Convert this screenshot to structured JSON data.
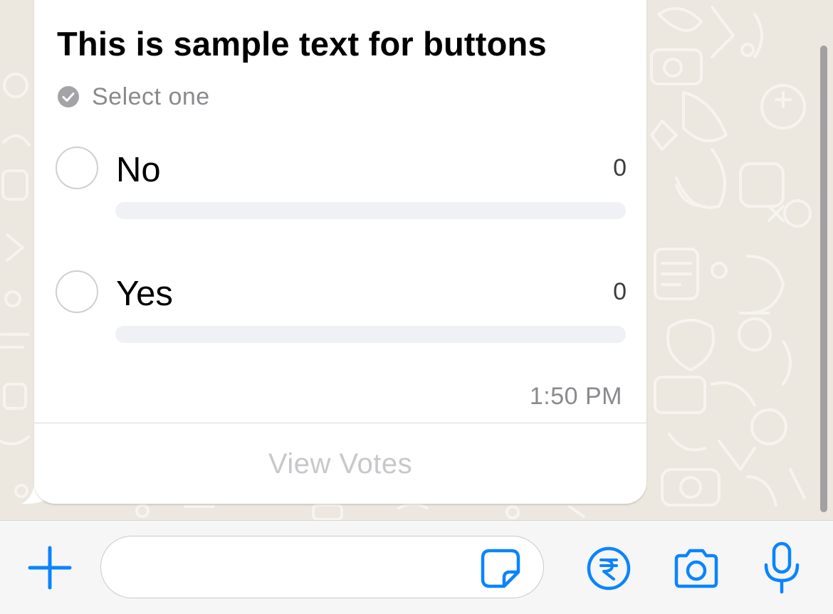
{
  "poll": {
    "title": "This is sample text for buttons",
    "instruction": "Select one",
    "options": [
      {
        "label": "No",
        "votes": "0",
        "fill_fraction": 0
      },
      {
        "label": "Yes",
        "votes": "0",
        "fill_fraction": 0
      }
    ],
    "timestamp": "1:50 PM",
    "view_votes_label": "View Votes"
  },
  "input_bar": {
    "message_value": "",
    "icons": [
      "plus-icon",
      "sticker-icon",
      "rupee-payment-icon",
      "camera-icon",
      "microphone-icon"
    ]
  },
  "colors": {
    "wallpaper": "#ece7df",
    "bubble": "#ffffff",
    "accent_blue": "#0a84ff",
    "muted_text": "#8a8a8e",
    "bar_track": "#f0f1f5"
  }
}
